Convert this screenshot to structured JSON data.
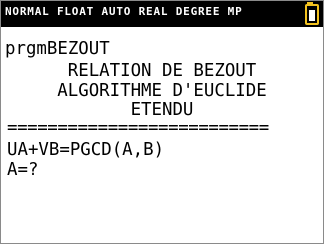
{
  "status_bar": {
    "modes": "NORMAL FLOAT AUTO REAL DEGREE MP",
    "battery_icon": "battery-icon",
    "accent_color": "#f3c21f"
  },
  "home_screen": {
    "command": "prgmBEZOUT",
    "title_line_1": "RELATION DE BEZOUT",
    "title_line_2": "ALGORITHME D'EUCLIDE",
    "title_line_3": "ETENDU",
    "separator": "==========================",
    "equation": "UA+VB=PGCD(A,B)",
    "input_prompt": "A=?"
  }
}
